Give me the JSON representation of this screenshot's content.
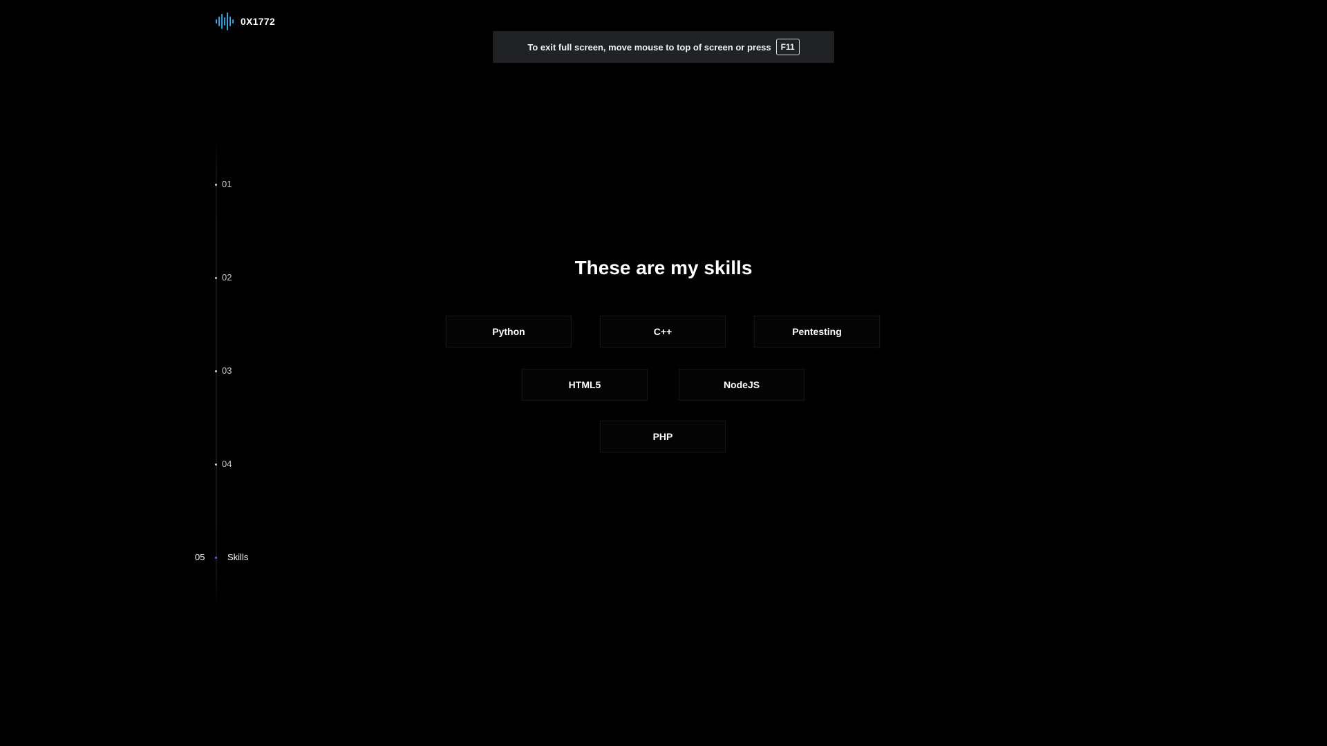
{
  "brand": {
    "name": "0X1772",
    "icon": "soundwave-icon",
    "icon_colors": [
      "#1e90ff",
      "#22b8e6",
      "#3ad0c8"
    ]
  },
  "fullscreen_banner": {
    "text": "To exit full screen, move mouse to top of screen or press",
    "key": "F11"
  },
  "timeline": {
    "items": [
      {
        "number": "01",
        "label": ""
      },
      {
        "number": "02",
        "label": ""
      },
      {
        "number": "03",
        "label": ""
      },
      {
        "number": "04",
        "label": ""
      },
      {
        "number": "05",
        "label": "Skills",
        "active": true
      }
    ],
    "active_color": "#5b6cff"
  },
  "skills": {
    "title": "These are my skills",
    "items": [
      "Python",
      "C++",
      "Pentesting",
      "HTML5",
      "NodeJS",
      "PHP"
    ]
  }
}
